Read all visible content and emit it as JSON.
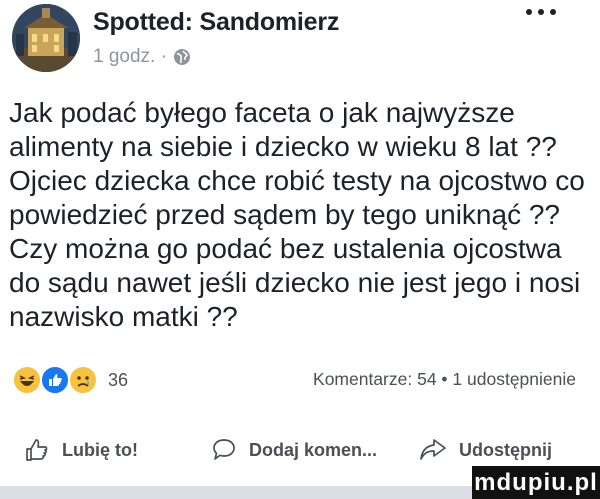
{
  "header": {
    "page_name": "Spotted: Sandomierz",
    "time": "1 godz. ·",
    "privacy_icon": "globe-icon",
    "more_icon": "more-dots-icon"
  },
  "post": {
    "lines": [
      "Jak podać byłego faceta o jak najwyższe",
      "alimenty na siebie i dziecko w wieku 8 lat ??",
      "Ojciec dziecka chce robić testy na ojcostwo co",
      "powiedzieć przed sądem by tego uniknąć ??",
      "Czy można go podać bez ustalenia ojcostwa",
      "do sądu nawet jeśli dziecko nie jest jego i nosi",
      "nazwisko matki ??"
    ]
  },
  "reactions": {
    "icons": [
      "haha-icon",
      "like-icon",
      "sad-icon"
    ],
    "count": "36",
    "stats": "Komentarze: 54 • 1 udostępnienie"
  },
  "actions": {
    "like": "Lubię to!",
    "comment": "Dodaj komen...",
    "share": "Udostępnij"
  },
  "watermark": "mdupiu.pl",
  "colors": {
    "text": "#1d2129",
    "secondary": "#90949c",
    "like_blue": "#1877f2",
    "emoji_yellow": "#f7c33f"
  }
}
